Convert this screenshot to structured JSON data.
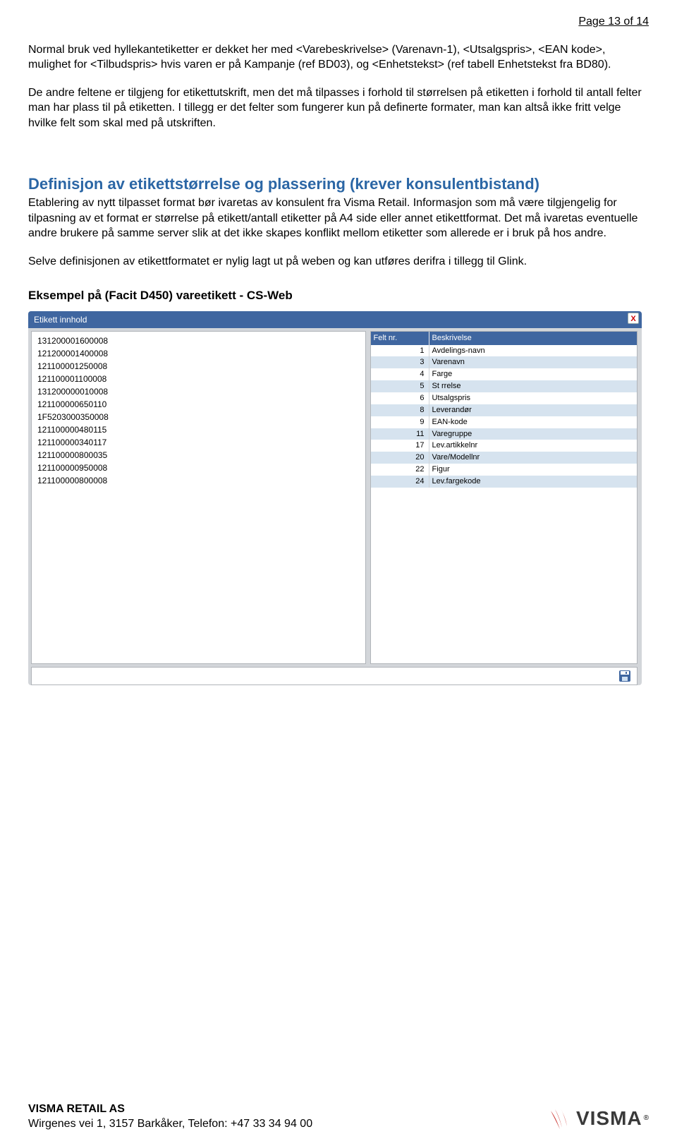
{
  "page_number": "Page 13 of 14",
  "para1": "Normal bruk ved hyllekantetiketter er dekket her med <Varebeskrivelse> (Varenavn-1), <Utsalgspris>, <EAN kode>, mulighet for <Tilbudspris> hvis varen er på Kampanje (ref BD03), og <Enhetstekst> (ref tabell Enhetstekst fra BD80).",
  "para2": "De andre feltene er tilgjeng for etikettutskrift, men det må tilpasses i forhold til størrelsen på etiketten i forhold til antall felter man har plass til på etiketten.  I tillegg er det felter som fungerer kun på definerte formater, man kan altså ikke fritt velge hvilke felt som skal med på utskriften.",
  "section_head": "Definisjon av etikettstørrelse og plassering (krever konsulentbistand)",
  "para3": "Etablering av nytt tilpasset format bør ivaretas av konsulent fra Visma Retail. Informasjon som må være tilgjengelig for tilpasning av et format er størrelse på etikett/antall etiketter på A4 side eller annet etikettformat. Det må ivaretas eventuelle andre brukere på samme server slik at det ikke skapes konflikt mellom etiketter som allerede er i bruk på hos andre.",
  "para4": "Selve definisjonen av etikettformatet er nylig lagt ut på weben og kan utføres derifra i tillegg til Glink.",
  "example_head": "Eksempel på (Facit D450) vareetikett - CS-Web",
  "panel": {
    "title": "Etikett innhold",
    "close": "X",
    "codes": [
      "131200001600008",
      "121200001400008",
      "121100001250008",
      "121100001100008",
      "131200000010008",
      "121100000650110",
      "1F5203000350008",
      "121100000480115",
      "121100000340117",
      "121100000800035",
      "121100000950008",
      "121100000800008"
    ],
    "col1": "Felt nr.",
    "col2": "Beskrivelse",
    "rows": [
      {
        "nr": "1",
        "txt": "Avdelings-navn"
      },
      {
        "nr": "3",
        "txt": "Varenavn"
      },
      {
        "nr": "4",
        "txt": "Farge"
      },
      {
        "nr": "5",
        "txt": "St rrelse"
      },
      {
        "nr": "6",
        "txt": "Utsalgspris"
      },
      {
        "nr": "8",
        "txt": "Leverandør"
      },
      {
        "nr": "9",
        "txt": "EAN-kode"
      },
      {
        "nr": "11",
        "txt": "Varegruppe"
      },
      {
        "nr": "17",
        "txt": "Lev.artikkelnr"
      },
      {
        "nr": "20",
        "txt": "Vare/Modellnr"
      },
      {
        "nr": "22",
        "txt": "Figur"
      },
      {
        "nr": "24",
        "txt": "Lev.fargekode"
      }
    ]
  },
  "footer": {
    "company": "VISMA RETAIL AS",
    "address": "Wirgenes vei 1, 3157 Barkåker, Telefon: +47 33 34 94 00",
    "brand": "VISMA"
  }
}
